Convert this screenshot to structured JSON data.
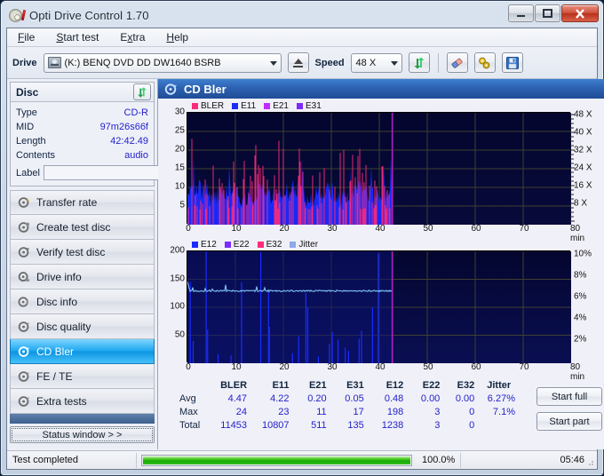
{
  "window": {
    "title": "Opti Drive Control 1.70",
    "icon": "optical-disc-icon",
    "controls": {
      "minimize": "–",
      "maximize": "□",
      "close": "✕"
    }
  },
  "menu": [
    {
      "label": "File",
      "accel": "F"
    },
    {
      "label": "Start test",
      "accel": "S"
    },
    {
      "label": "Extra",
      "accel": "x"
    },
    {
      "label": "Help",
      "accel": "H"
    }
  ],
  "toolbar": {
    "drive_label": "Drive",
    "drive_value": "(K:)  BENQ DVD DD DW1640 BSRB",
    "eject_icon": "eject-icon",
    "speed_label": "Speed",
    "speed_value": "48 X",
    "refresh_icon": "refresh-icon",
    "eraser_icon": "eraser-icon",
    "tools_icon": "tools-icon",
    "save_icon": "save-icon"
  },
  "disc": {
    "title": "Disc",
    "refresh_icon": "refresh-icon",
    "rows": [
      {
        "key": "Type",
        "value": "CD-R"
      },
      {
        "key": "MID",
        "value": "97m26s66f"
      },
      {
        "key": "Length",
        "value": "42:42.49"
      },
      {
        "key": "Contents",
        "value": "audio"
      }
    ],
    "label_key": "Label",
    "label_value": "",
    "label_button_icon": "disc-icon"
  },
  "sidebar": {
    "items": [
      {
        "label": "Transfer rate",
        "icon": "disc-test-icon",
        "active": false
      },
      {
        "label": "Create test disc",
        "icon": "disc-burn-icon",
        "active": false
      },
      {
        "label": "Verify test disc",
        "icon": "disc-check-icon",
        "active": false
      },
      {
        "label": "Drive info",
        "icon": "drive-info-icon",
        "active": false
      },
      {
        "label": "Disc info",
        "icon": "disc-info-icon",
        "active": false
      },
      {
        "label": "Disc quality",
        "icon": "disc-quality-icon",
        "active": false
      },
      {
        "label": "CD Bler",
        "icon": "cd-bler-icon",
        "active": true
      },
      {
        "label": "FE / TE",
        "icon": "fe-te-icon",
        "active": false
      },
      {
        "label": "Extra tests",
        "icon": "extra-tests-icon",
        "active": false
      }
    ],
    "status_window_label": "Status window > >"
  },
  "panel": {
    "title": "CD Bler",
    "icon": "cd-bler-icon",
    "start_full": "Start full",
    "start_part": "Start part"
  },
  "stats": {
    "columns": [
      "BLER",
      "E11",
      "E21",
      "E31",
      "E12",
      "E22",
      "E32",
      "Jitter"
    ],
    "rows": [
      {
        "label": "Avg",
        "values": [
          "4.47",
          "4.22",
          "0.20",
          "0.05",
          "0.48",
          "0.00",
          "0.00",
          "6.27%"
        ]
      },
      {
        "label": "Max",
        "values": [
          "24",
          "23",
          "11",
          "17",
          "198",
          "3",
          "0",
          "7.1%"
        ]
      },
      {
        "label": "Total",
        "values": [
          "11453",
          "10807",
          "511",
          "135",
          "1238",
          "3",
          "0",
          ""
        ]
      }
    ]
  },
  "statusbar": {
    "message": "Test completed",
    "percent_text": "100.0%",
    "percent_value": 100,
    "elapsed": "05:46"
  },
  "colors": {
    "bler": "#ff2b7a",
    "e11": "#1a2bff",
    "e21": "#a22bff",
    "e31": "#7d2bff",
    "e12": "#1a2bff",
    "e22": "#7d2bff",
    "e32": "#ff2b7a",
    "jitter": "#7a9bdd",
    "plot_bg": "#03052b",
    "accent": "#1f4d96",
    "value_text": "#2222cc",
    "progress": "#18a908"
  },
  "chart_data": [
    {
      "type": "line",
      "name": "CD BLER / E11 / E21 / E31 vs position",
      "title": "",
      "xlabel": "min",
      "ylabel": "",
      "xlim": [
        0,
        80
      ],
      "ylim": [
        0,
        30
      ],
      "xticks": [
        0,
        10,
        20,
        30,
        40,
        50,
        60,
        70,
        80
      ],
      "xtick_labels": [
        "0",
        "10",
        "20",
        "30",
        "40",
        "50",
        "60",
        "70",
        "80 min"
      ],
      "yticks": [
        5,
        10,
        15,
        20,
        25,
        30
      ],
      "ytick_labels": [
        "5",
        "10",
        "15",
        "20",
        "25",
        "30"
      ],
      "right_axis": {
        "label": "speed",
        "ticks": [
          8,
          16,
          24,
          32,
          40,
          48
        ],
        "tick_labels": [
          "8 X",
          "16 X",
          "24 X",
          "32 X",
          "40 X",
          "48 X"
        ],
        "lim": [
          0,
          48
        ]
      },
      "legend": [
        "BLER",
        "E11",
        "E21",
        "E31"
      ],
      "legend_position": "top-left",
      "grid": true,
      "data_end_min": 42.7,
      "series": [
        {
          "name": "BLER",
          "color": "#ff2b7a",
          "avg": 4.47,
          "max": 24,
          "total": 11453
        },
        {
          "name": "E11",
          "color": "#1a2bff",
          "avg": 4.22,
          "max": 23,
          "total": 10807
        },
        {
          "name": "E21",
          "color": "#a22bff",
          "avg": 0.2,
          "max": 11,
          "total": 511
        },
        {
          "name": "E31",
          "color": "#7d2bff",
          "avg": 0.05,
          "max": 17,
          "total": 135
        }
      ]
    },
    {
      "type": "line",
      "name": "CD E12 / E22 / E32 / Jitter vs position",
      "title": "",
      "xlabel": "min",
      "ylabel": "",
      "xlim": [
        0,
        80
      ],
      "ylim": [
        0,
        200
      ],
      "xticks": [
        0,
        10,
        20,
        30,
        40,
        50,
        60,
        70,
        80
      ],
      "xtick_labels": [
        "0",
        "10",
        "20",
        "30",
        "40",
        "50",
        "60",
        "70",
        "80 min"
      ],
      "yticks": [
        50,
        100,
        150,
        200
      ],
      "ytick_labels": [
        "50",
        "100",
        "150",
        "200"
      ],
      "right_axis": {
        "label": "jitter",
        "ticks": [
          2,
          4,
          6,
          8,
          10
        ],
        "tick_labels": [
          "2%",
          "4%",
          "6%",
          "8%",
          "10%"
        ],
        "lim": [
          0,
          10
        ]
      },
      "legend": [
        "E12",
        "E22",
        "E32",
        "Jitter"
      ],
      "legend_position": "top-left",
      "grid": true,
      "data_end_min": 42.7,
      "jitter_baseline_pct": 6.3,
      "series": [
        {
          "name": "E12",
          "color": "#1a2bff",
          "avg": 0.48,
          "max": 198,
          "total": 1238
        },
        {
          "name": "E22",
          "color": "#7d2bff",
          "avg": 0.0,
          "max": 3,
          "total": 3
        },
        {
          "name": "E32",
          "color": "#ff2b7a",
          "avg": 0.0,
          "max": 0,
          "total": 0
        },
        {
          "name": "Jitter",
          "color": "#7a9bdd",
          "avg": "6.27%",
          "max": "7.1%",
          "total": ""
        }
      ]
    }
  ]
}
